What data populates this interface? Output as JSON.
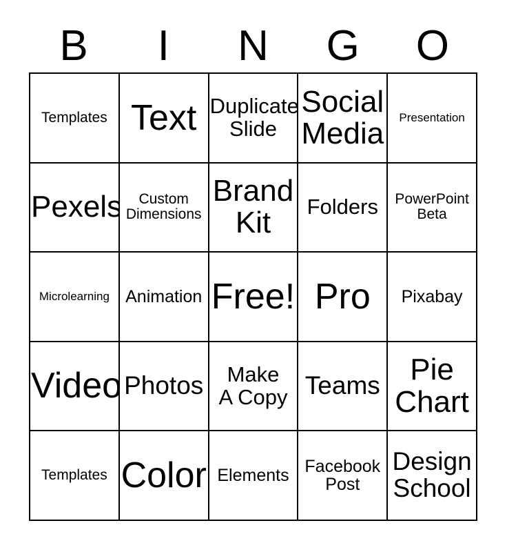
{
  "card": {
    "type": "bingo-card",
    "columns": 5,
    "rows": 5,
    "header_letters": [
      "B",
      "I",
      "N",
      "G",
      "O"
    ],
    "border_color": "#000000",
    "background_color": "#ffffff",
    "text_color": "#000000",
    "free_space_label": "Free!",
    "free_space_index": 12,
    "cells": [
      {
        "text": "Templates",
        "size": "fs-s"
      },
      {
        "text": "Text",
        "size": "fs-xxxl"
      },
      {
        "text": "Duplicate\nSlide",
        "size": "fs-l"
      },
      {
        "text": "Social\nMedia",
        "size": "fs-xxl"
      },
      {
        "text": "Presentation",
        "size": "fs-xs"
      },
      {
        "text": "Pexels",
        "size": "fs-xxl"
      },
      {
        "text": "Custom\nDimensions",
        "size": "fs-s"
      },
      {
        "text": "Brand\nKit",
        "size": "fs-xxl"
      },
      {
        "text": "Folders",
        "size": "fs-l"
      },
      {
        "text": "PowerPoint\nBeta",
        "size": "fs-s"
      },
      {
        "text": "Microlearning",
        "size": "fs-xs"
      },
      {
        "text": "Animation",
        "size": "fs-m"
      },
      {
        "text": "Free!",
        "size": "fs-xxxl"
      },
      {
        "text": "Pro",
        "size": "fs-xxxl"
      },
      {
        "text": "Pixabay",
        "size": "fs-m"
      },
      {
        "text": "Video",
        "size": "fs-xxxl"
      },
      {
        "text": "Photos",
        "size": "fs-xl"
      },
      {
        "text": "Make\nA Copy",
        "size": "fs-l"
      },
      {
        "text": "Teams",
        "size": "fs-xl"
      },
      {
        "text": "Pie\nChart",
        "size": "fs-xxl"
      },
      {
        "text": "Templates",
        "size": "fs-s"
      },
      {
        "text": "Color",
        "size": "fs-xxxl"
      },
      {
        "text": "Elements",
        "size": "fs-m"
      },
      {
        "text": "Facebook\nPost",
        "size": "fs-m"
      },
      {
        "text": "Design\nSchool",
        "size": "fs-xl"
      }
    ]
  }
}
